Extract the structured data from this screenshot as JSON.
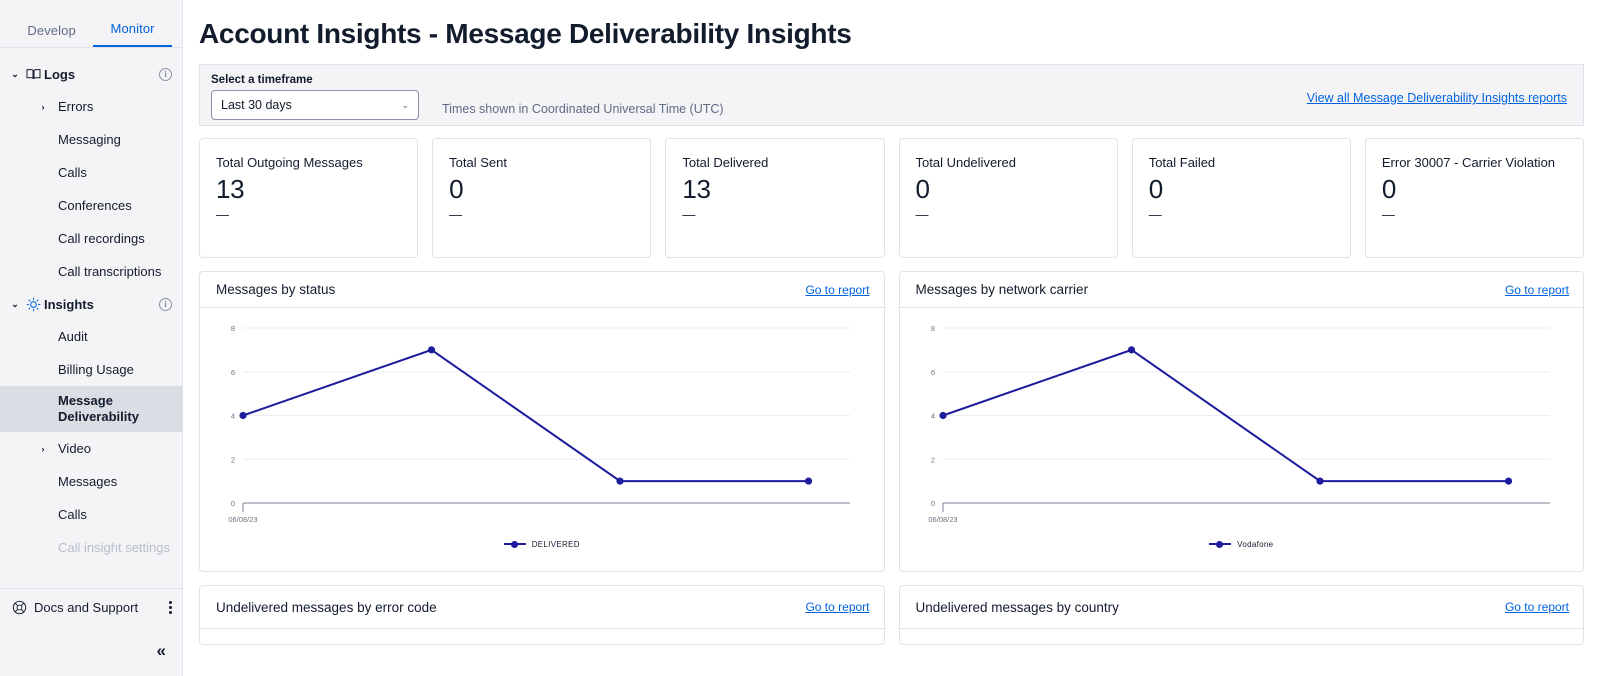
{
  "sidebar": {
    "tabs": [
      {
        "label": "Develop",
        "active": false
      },
      {
        "label": "Monitor",
        "active": true
      }
    ],
    "groups": [
      {
        "label": "Logs",
        "icon": "book-icon"
      },
      {
        "label": "Insights",
        "icon": "lightbulb-icon"
      }
    ],
    "logs_items": [
      {
        "label": "Errors",
        "expandable": true
      },
      {
        "label": "Messaging"
      },
      {
        "label": "Calls"
      },
      {
        "label": "Conferences"
      },
      {
        "label": "Call recordings"
      },
      {
        "label": "Call transcriptions"
      }
    ],
    "insights_items": [
      {
        "label": "Audit"
      },
      {
        "label": "Billing Usage"
      },
      {
        "label": "Message Deliverability",
        "selected": true
      },
      {
        "label": "Video",
        "expandable": true
      },
      {
        "label": "Messages"
      },
      {
        "label": "Calls"
      },
      {
        "label": "Call insight settings",
        "dim": true
      }
    ],
    "docs_support": "Docs and Support",
    "collapse_label": "«",
    "caret_down": "⌄",
    "caret_right": "›",
    "info_char": "i"
  },
  "header": {
    "title": "Account Insights - Message Deliverability Insights"
  },
  "filter": {
    "timeframe_label": "Select a timeframe",
    "timeframe_value": "Last 30 days",
    "timeframe_chevron": "⌄",
    "utc_note": "Times shown in Coordinated Universal Time (UTC)",
    "view_all_link": "View all Message Deliverability Insights reports"
  },
  "kpis": [
    {
      "label": "Total Outgoing Messages",
      "value": "13",
      "sub": "—"
    },
    {
      "label": "Total Sent",
      "value": "0",
      "sub": "—"
    },
    {
      "label": "Total Delivered",
      "value": "13",
      "sub": "—"
    },
    {
      "label": "Total Undelivered",
      "value": "0",
      "sub": "—"
    },
    {
      "label": "Total Failed",
      "value": "0",
      "sub": "—"
    },
    {
      "label": "Error 30007 - Carrier Violation",
      "value": "0",
      "sub": "—"
    }
  ],
  "cards": {
    "messages_by_status": {
      "title": "Messages by status",
      "link": "Go to report"
    },
    "messages_by_carrier": {
      "title": "Messages by network carrier",
      "link": "Go to report"
    },
    "undelivered_by_error": {
      "title": "Undelivered messages by error code",
      "link": "Go to report"
    },
    "undelivered_by_country": {
      "title": "Undelivered messages by country",
      "link": "Go to report"
    }
  },
  "colors": {
    "accent_link": "#0263e0",
    "series_line": "#1c1c9c",
    "selected_nav_bg": "#dbdde5",
    "panel_bg": "#f4f4f6",
    "border": "#e1e3ea"
  },
  "chart_data": [
    {
      "type": "line",
      "title": "Messages by status",
      "xlabel": "",
      "ylabel": "",
      "x": [
        "06/08/23",
        "",
        "",
        ""
      ],
      "x_ticklabels": [
        "06/08/23"
      ],
      "yticks": [
        0,
        2,
        4,
        6,
        8
      ],
      "ylim": [
        0,
        8
      ],
      "grid": true,
      "legend_position": "bottom",
      "series": [
        {
          "name": "DELIVERED",
          "values": [
            4,
            7,
            1,
            1
          ],
          "color": "#1c1c9c"
        }
      ]
    },
    {
      "type": "line",
      "title": "Messages by network carrier",
      "xlabel": "",
      "ylabel": "",
      "x": [
        "06/08/23",
        "",
        "",
        ""
      ],
      "x_ticklabels": [
        "06/08/23"
      ],
      "yticks": [
        0,
        2,
        4,
        6,
        8
      ],
      "ylim": [
        0,
        8
      ],
      "grid": true,
      "legend_position": "bottom",
      "series": [
        {
          "name": "Vodafone",
          "values": [
            4,
            7,
            1,
            1
          ],
          "color": "#1c1c9c"
        }
      ]
    }
  ]
}
